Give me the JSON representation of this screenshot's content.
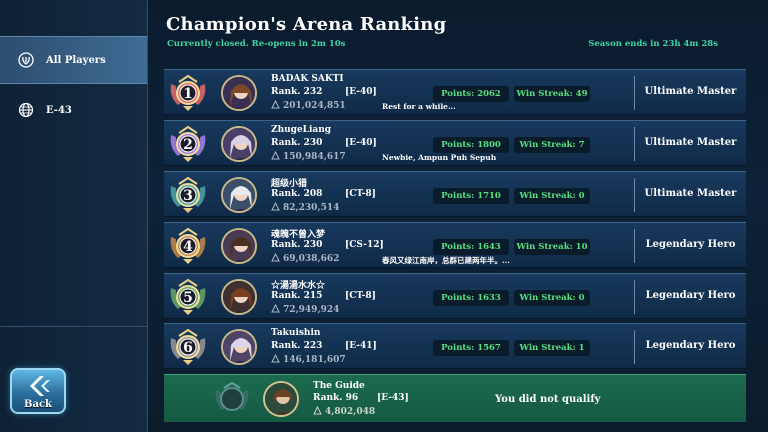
{
  "header": {
    "title": "Champion's Arena Ranking",
    "status": "Currently closed. Re-opens in  2m 10s",
    "season": "Season ends in  23h 4m 28s"
  },
  "sidebar": {
    "items": [
      {
        "label": "All Players",
        "icon": "laurel-icon",
        "active": true
      },
      {
        "label": "E-43",
        "icon": "globe-icon",
        "active": false
      }
    ],
    "back_label": "Back"
  },
  "rankings": [
    {
      "place": "1",
      "name": "BADAK SAKTI",
      "rank": "Rank. 232",
      "server": "[E-40]",
      "power": "201,024,851",
      "motto": "Rest for a while...",
      "points": "Points: 2062",
      "streak": "Win Streak: 49",
      "tier": "Ultimate Master",
      "medal_color": "#e86a6a"
    },
    {
      "place": "2",
      "name": "ZhugeLiang",
      "rank": "Rank. 230",
      "server": "[E-40]",
      "power": "150,984,617",
      "motto": "Newbie, Ampun Puh Sepuh",
      "points": "Points: 1800",
      "streak": "Win Streak: 7",
      "tier": "Ultimate Master",
      "medal_color": "#a883e6"
    },
    {
      "place": "3",
      "name": "超级小猎",
      "rank": "Rank. 208",
      "server": "[CT-8]",
      "power": "82,230,514",
      "motto": "",
      "points": "Points: 1710",
      "streak": "Win Streak: 0",
      "tier": "Ultimate Master",
      "medal_color": "#4fa6a6"
    },
    {
      "place": "4",
      "name": "魂魄不曾入梦",
      "rank": "Rank. 230",
      "server": "[CS-12]",
      "power": "69,038,662",
      "motto": "春风又绿江南岸，总群已建两年半。...",
      "points": "Points: 1643",
      "streak": "Win Streak: 10",
      "tier": "Legendary Hero",
      "medal_color": "#c58a4a"
    },
    {
      "place": "5",
      "name": "☆湯湯水水☆",
      "rank": "Rank. 215",
      "server": "[CT-8]",
      "power": "72,949,924",
      "motto": "",
      "points": "Points: 1633",
      "streak": "Win Streak: 0",
      "tier": "Legendary Hero",
      "medal_color": "#6aa86a"
    },
    {
      "place": "6",
      "name": "Takuishin",
      "rank": "Rank. 223",
      "server": "[E-41]",
      "power": "146,181,607",
      "motto": "",
      "points": "Points: 1567",
      "streak": "Win Streak: 1",
      "tier": "Legendary Hero",
      "medal_color": "#9a9a9a"
    }
  ],
  "self": {
    "name": "The Guide",
    "rank": "Rank. 96",
    "server": "[E-43]",
    "power": "4,802,048",
    "status": "You did not qualify"
  },
  "colors": {
    "accent_green": "#58e07e",
    "status_teal": "#3fd3a4",
    "self_row": "#1c6a4f"
  }
}
